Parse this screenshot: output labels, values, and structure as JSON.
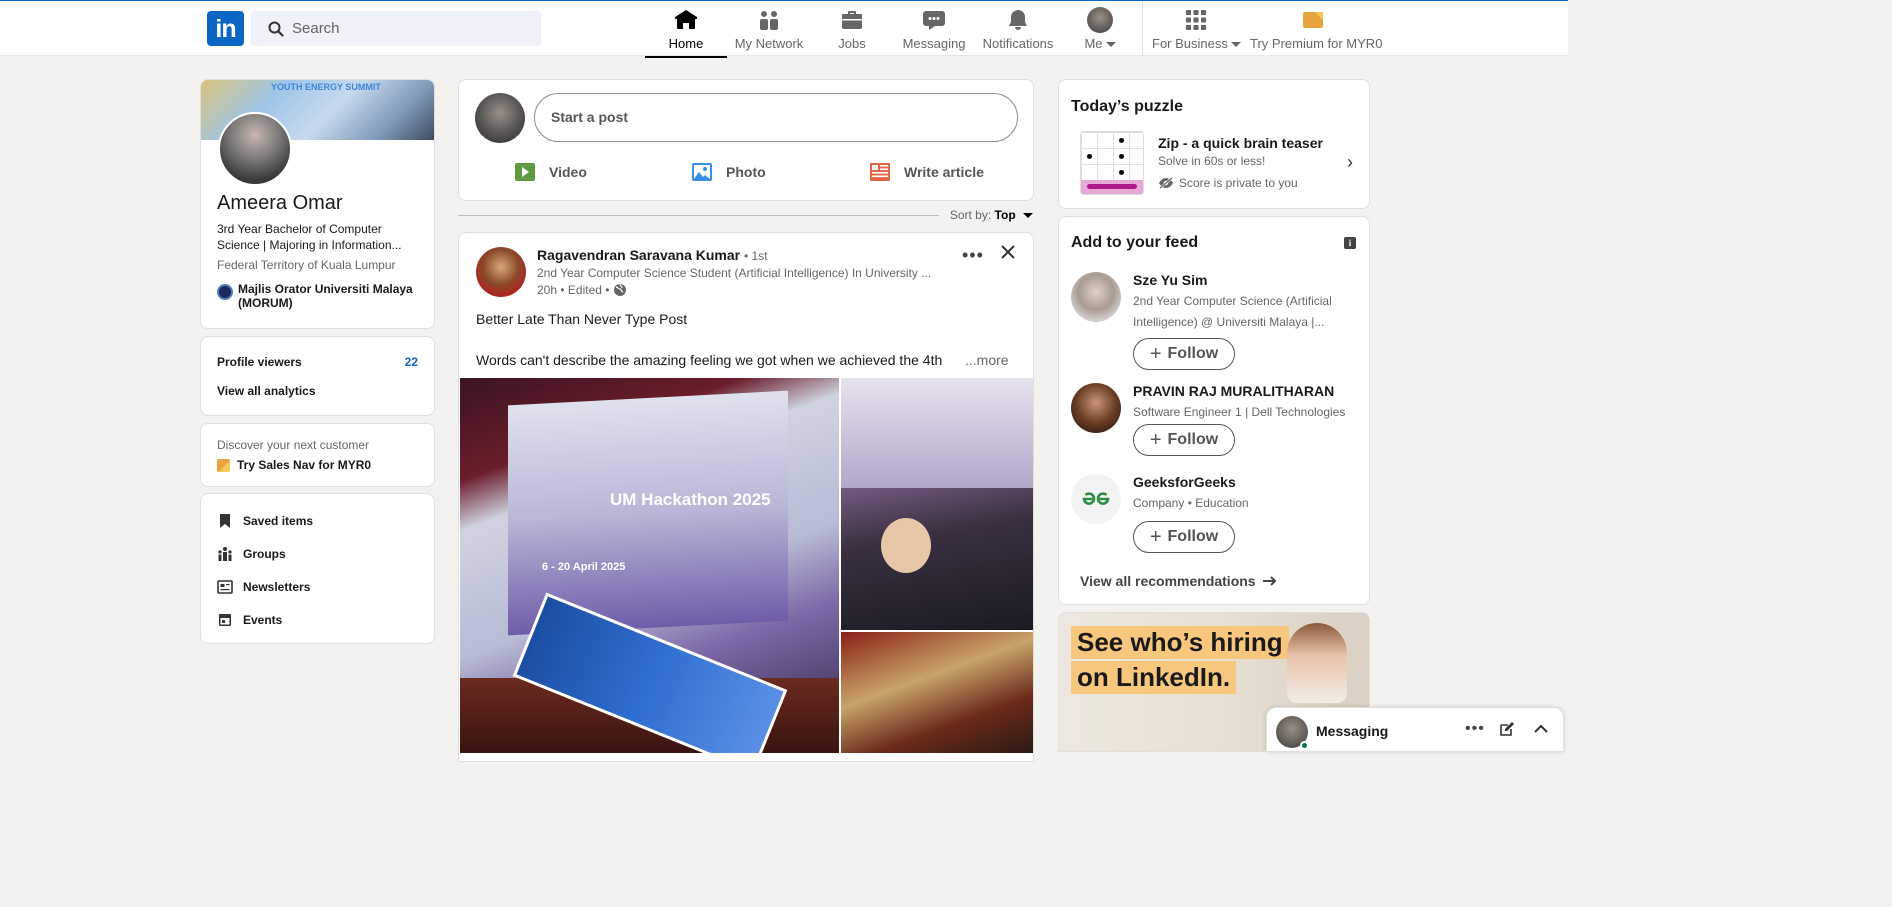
{
  "header": {
    "logo_text": "in",
    "search_placeholder": "Search",
    "nav": [
      {
        "label": "Home",
        "icon": "home-icon"
      },
      {
        "label": "My Network",
        "icon": "network-icon"
      },
      {
        "label": "Jobs",
        "icon": "briefcase-icon"
      },
      {
        "label": "Messaging",
        "icon": "messaging-icon"
      },
      {
        "label": "Notifications",
        "icon": "bell-icon"
      },
      {
        "label": "Me",
        "icon": "avatar"
      },
      {
        "label": "For Business",
        "icon": "grid-icon"
      },
      {
        "label": "Try Premium for MYR0",
        "icon": "premium-icon"
      }
    ],
    "active_nav": "Home"
  },
  "profile": {
    "name": "Ameera Omar",
    "headline": "3rd Year Bachelor of Computer Science | Majoring in Information...",
    "location": "Federal Territory of Kuala Lumpur",
    "organization": "Majlis Orator Universiti Malaya (MORUM)",
    "cover_text": "YOUTH ENERGY SUMMIT"
  },
  "analytics": {
    "viewers_label": "Profile viewers",
    "viewers_count": "22",
    "view_all_label": "View all analytics"
  },
  "sales_nav": {
    "discover_label": "Discover your next customer",
    "try_label": "Try Sales Nav for MYR0"
  },
  "shortcuts": [
    {
      "label": "Saved items",
      "icon": "bookmark-icon"
    },
    {
      "label": "Groups",
      "icon": "groups-icon"
    },
    {
      "label": "Newsletters",
      "icon": "newsletter-icon"
    },
    {
      "label": "Events",
      "icon": "calendar-icon"
    }
  ],
  "composer": {
    "placeholder": "Start a post",
    "video_label": "Video",
    "photo_label": "Photo",
    "article_label": "Write article",
    "colors": {
      "video": "#5f9b41",
      "photo": "#378fe9",
      "article": "#e06847"
    }
  },
  "sort": {
    "label": "Sort by:",
    "value": "Top"
  },
  "post": {
    "author": "Ragavendran Saravana Kumar",
    "degree": "• 1st",
    "author_headline": "2nd Year Computer Science Student (Artificial Intelligence) In University ...",
    "time": "20h • Edited •",
    "text_line1": "Better Late Than Never Type Post",
    "text_line2": "Words can't describe the amazing feeling we got when we achieved the 4th",
    "more_label": "...more",
    "image_title": "UM Hackathon 2025",
    "image_date": "6 - 20 April 2025"
  },
  "puzzle": {
    "section_title": "Today’s puzzle",
    "name": "Zip - a quick brain teaser",
    "subtitle": "Solve in 60s or less!",
    "privacy": "Score is private to you"
  },
  "feed_recs": {
    "section_title": "Add to your feed",
    "follow_label": "Follow",
    "items": [
      {
        "name": "Sze Yu Sim",
        "sub": "2nd Year Computer Science (Artificial Intelligence) @ Universiti Malaya |..."
      },
      {
        "name": "PRAVIN RAJ MURALITHARAN",
        "sub": "Software Engineer 1 | Dell Technologies"
      },
      {
        "name": "GeeksforGeeks",
        "sub": "Company • Education"
      }
    ],
    "view_all_label": "View all recommendations"
  },
  "ad": {
    "line1": "See who’s hiring",
    "line2": "on LinkedIn."
  },
  "messaging_bar": {
    "label": "Messaging"
  },
  "colors": {
    "brand": "#0a66c2",
    "background": "#f4f2ee",
    "online": "#01754f"
  }
}
